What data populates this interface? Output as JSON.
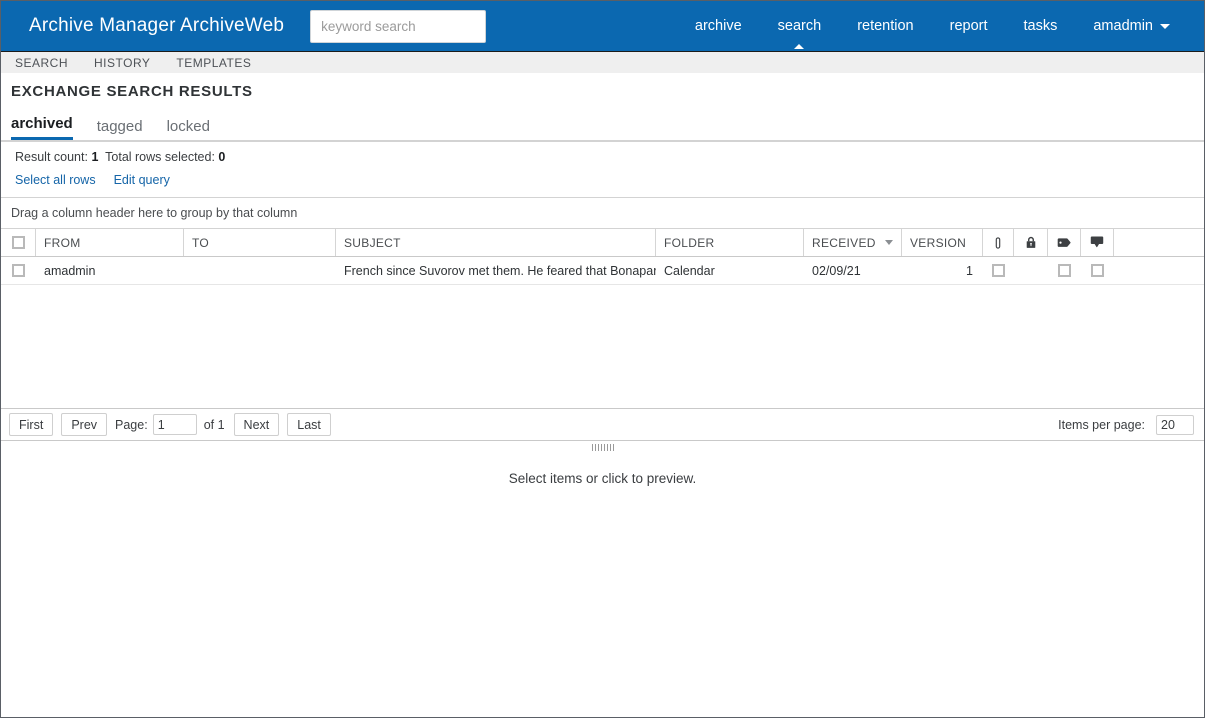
{
  "header": {
    "brand": "Archive Manager ArchiveWeb",
    "search_placeholder": "keyword search",
    "search_value": "",
    "nav": [
      {
        "label": "archive",
        "active": false
      },
      {
        "label": "search",
        "active": true
      },
      {
        "label": "retention",
        "active": false
      },
      {
        "label": "report",
        "active": false
      },
      {
        "label": "tasks",
        "active": false
      }
    ],
    "user": "amadmin"
  },
  "subnav": {
    "items": [
      "SEARCH",
      "HISTORY",
      "TEMPLATES"
    ]
  },
  "page": {
    "title": "EXCHANGE SEARCH RESULTS",
    "tabs": [
      {
        "label": "archived",
        "active": true
      },
      {
        "label": "tagged",
        "active": false
      },
      {
        "label": "locked",
        "active": false
      }
    ]
  },
  "results": {
    "result_count_label": "Result count:",
    "result_count_value": "1",
    "total_selected_label": "Total rows selected:",
    "total_selected_value": "0",
    "select_all_rows": "Select all rows",
    "edit_query": "Edit query",
    "grouping_hint": "Drag a column header here to group by that column"
  },
  "grid": {
    "columns": [
      {
        "key": "select",
        "label": "",
        "icon": "checkbox-icon"
      },
      {
        "key": "from",
        "label": "FROM"
      },
      {
        "key": "to",
        "label": "TO"
      },
      {
        "key": "subject",
        "label": "SUBJECT"
      },
      {
        "key": "folder",
        "label": "FOLDER"
      },
      {
        "key": "received",
        "label": "RECEIVED",
        "sort": "desc"
      },
      {
        "key": "version",
        "label": "VERSION"
      },
      {
        "key": "attachment",
        "label": "",
        "icon": "paperclip-icon"
      },
      {
        "key": "locked",
        "label": "",
        "icon": "lock-icon"
      },
      {
        "key": "tag",
        "label": "",
        "icon": "tag-icon"
      },
      {
        "key": "note",
        "label": "",
        "icon": "comment-icon"
      },
      {
        "key": "spacer",
        "label": ""
      }
    ],
    "rows": [
      {
        "selected": false,
        "from": "amadmin",
        "to": "",
        "subject": "French since Suvorov met them. He feared that Bonapart...",
        "folder": "Calendar",
        "received": "02/09/21",
        "version": "1",
        "attachment": true,
        "locked": false,
        "tag": true,
        "note": true
      }
    ]
  },
  "pager": {
    "first": "First",
    "prev": "Prev",
    "page_label": "Page:",
    "page_value": "1",
    "of_text": "of 1",
    "next": "Next",
    "last": "Last",
    "items_per_page_label": "Items per page:",
    "items_per_page_value": "20"
  },
  "preview": {
    "message": "Select items or click to preview."
  },
  "colors": {
    "brand_blue": "#0b68b0",
    "link_blue": "#1565a8",
    "subnav_bg": "#efefef",
    "border_gray": "#d3d3d3"
  }
}
